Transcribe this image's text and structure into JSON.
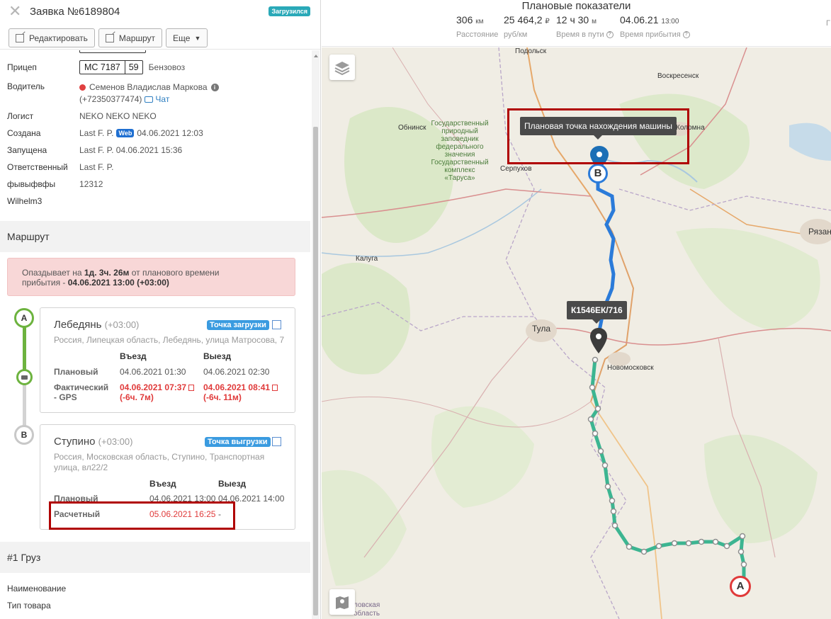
{
  "header": {
    "title": "Заявка №6189804",
    "status": "Загрузился",
    "buttons": {
      "edit": "Редактировать",
      "route": "Маршрут",
      "more": "Еще"
    }
  },
  "fields": {
    "trailer_label": "Прицеп",
    "trailer_plate": "МС 7187",
    "trailer_region": "59",
    "trailer_type": "Бензовоз",
    "driver_label": "Водитель",
    "driver_name": "Семенов Владислав Маркова",
    "driver_phone": "(+72350377474)",
    "chat": "Чат",
    "logist_label": "Логист",
    "logist_value": "NEKO NEKO NEKO",
    "created_label": "Создана",
    "created_by": "Last F. P.",
    "created_web": "Web",
    "created_date": "04.06.2021 12:03",
    "started_label": "Запущена",
    "started_value": "Last F. P. 04.06.2021 15:36",
    "resp_label": "Ответственный",
    "resp_value": "Last F. P.",
    "custom_label": "фывыфвфы",
    "custom_value": "12312",
    "wilhelm_label": "Wilhelm3"
  },
  "route": {
    "section": "Маршрут",
    "alert_prefix": "Опаздывает на",
    "alert_delay": "1д. 3ч. 26м",
    "alert_mid": "от планового времени",
    "alert_line2_prefix": "прибытия -",
    "alert_time": "04.06.2021 13:00 (+03:00)",
    "points": [
      {
        "letter": "A",
        "city": "Лебедянь",
        "tz": "(+03:00)",
        "badge": "Точка загрузки",
        "address": "Россия, Липецкая область, Лебедянь, улица Матросова, 7",
        "col_in": "Въезд",
        "col_out": "Выезд",
        "plan_label": "Плановый",
        "plan_in": "04.06.2021 01:30",
        "plan_out": "04.06.2021 02:30",
        "fact_label1": "Фактический",
        "fact_label2": "- GPS",
        "fact_in": "04.06.2021 07:37",
        "fact_in_diff": "(-6ч. 7м)",
        "fact_out": "04.06.2021 08:41",
        "fact_out_diff": "(-6ч. 11м)"
      },
      {
        "letter": "B",
        "city": "Ступино",
        "tz": "(+03:00)",
        "badge": "Точка выгрузки",
        "address1": "Россия, Московская область, Ступино, Транспортная",
        "address2": "улица, вл22/2",
        "col_in": "Въезд",
        "col_out": "Выезд",
        "plan_label": "Плановый",
        "plan_in": "04.06.2021 13:00",
        "plan_out": "04.06.2021 14:00",
        "calc_label": "Расчетный",
        "calc_in": "05.06.2021 16:25",
        "calc_out": "-"
      }
    ]
  },
  "cargo": {
    "section": "#1 Груз",
    "name_label": "Наименование",
    "type_label": "Тип товара"
  },
  "map_header": {
    "title": "Плановые показатели",
    "metrics": [
      {
        "value": "306",
        "unit": "км",
        "label": "Расстояние"
      },
      {
        "value": "25 464,2",
        "unit": "₽",
        "label": "руб/км"
      },
      {
        "value": "12 ч 30",
        "unit": "м",
        "label": "Время в пути"
      },
      {
        "value": "04.06.21",
        "unit": "13:00",
        "label": "Время прибытия"
      },
      {
        "value": "",
        "unit": "",
        "label": "Г"
      }
    ]
  },
  "map": {
    "planned_tooltip": "Плановая точка нахождения машины",
    "vehicle_tooltip": "К1546ЕК/716",
    "marker_a": "A",
    "marker_b": "B",
    "labels": {
      "podolsk": "Подольск",
      "voskresensk": "Воскресенск",
      "obninsk": "Обнинск",
      "kolomna": "Коломна",
      "serpukhov": "Серпухов",
      "kaluga": "Калуга",
      "tula": "Тула",
      "novomoskovsk": "Новомосковск",
      "ryazan": "Рязань",
      "reserve": "Государственный\nприродный\nзаповедник\nфедерального\nзначения\nГосударственный\nкомплекс\n«Таруса»",
      "oblast": "ловская\nобласть"
    },
    "colors": {
      "route_blue": "#2b7bd9",
      "route_green": "#3cb591",
      "marker_a": "#e03a3a",
      "marker_b": "#2b7bd9"
    }
  }
}
